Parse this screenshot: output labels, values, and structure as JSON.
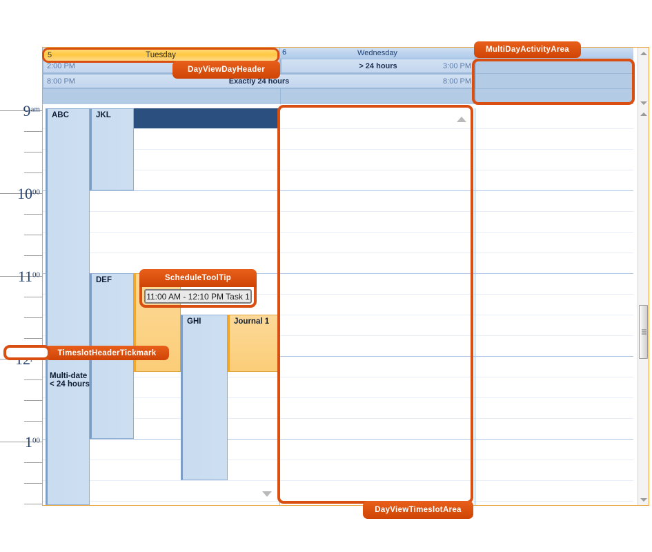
{
  "scheduler": {
    "day_headers": [
      {
        "number": "5",
        "name": "Tuesday",
        "highlighted": true
      },
      {
        "number": "6",
        "name": "Wednesday",
        "highlighted": false
      },
      {
        "number": "",
        "name": "",
        "highlighted": false
      }
    ],
    "multiday_rows": [
      {
        "segments": [
          {
            "left_text": "2:00 PM",
            "center_text": "",
            "right_text": ""
          },
          {
            "left_text": "",
            "center_text": "> 24 hours",
            "right_text": "3:00 PM"
          }
        ]
      },
      {
        "segments": [
          {
            "left_text": "8:00 PM",
            "center_text": "Exactly 24 hours",
            "right_text": "8:00 PM"
          }
        ]
      }
    ],
    "time_ruler": [
      {
        "hour": "9",
        "minutes": "am"
      },
      {
        "hour": "10",
        "minutes": "00"
      },
      {
        "hour": "11",
        "minutes": "00"
      },
      {
        "hour": "12",
        "minutes": "pm"
      },
      {
        "hour": "1",
        "minutes": "00"
      }
    ],
    "appointments": [
      {
        "id": "abc",
        "subject": "ABC",
        "style": "blue"
      },
      {
        "id": "jkl",
        "subject": "JKL",
        "style": "blue"
      },
      {
        "id": "def",
        "subject": "DEF",
        "style": "blue"
      },
      {
        "id": "task1",
        "subject": "Task 1",
        "style": "orange"
      },
      {
        "id": "ghi",
        "subject": "GHI",
        "style": "blue"
      },
      {
        "id": "journal1",
        "subject": "Journal 1",
        "style": "orange"
      },
      {
        "id": "multi",
        "subject": "Multi-date < 24 hours",
        "style": "blue"
      }
    ],
    "tooltip": {
      "text": "11:00 AM - 12:10 PM  Task 1"
    }
  },
  "callouts": {
    "day_view_day_header": "DayViewDayHeader",
    "multi_day_activity_area": "MultiDayActivityArea",
    "schedule_tooltip": "ScheduleToolTip",
    "timeslot_header_tickmark": "TimeslotHeaderTickmark",
    "day_view_timeslot_area": "DayViewTimeslotArea"
  },
  "colors": {
    "accent_orange": "#d94f11",
    "header_blue": "#b4cbe6",
    "selection_navy": "#2b4f7e",
    "appointment_orange": "#fbcd78",
    "appointment_blue": "#c9dcf0",
    "highlight_yellow": "#ffc83f"
  }
}
